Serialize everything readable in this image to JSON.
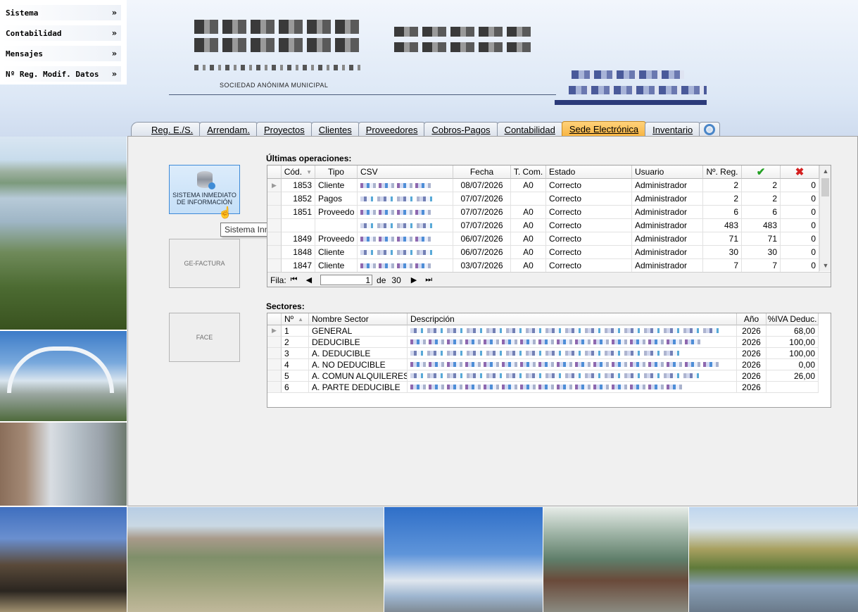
{
  "menu": {
    "items": [
      {
        "label": "Sistema"
      },
      {
        "label": "Contabilidad"
      },
      {
        "label": "Mensajes"
      },
      {
        "label": "Nº Reg. Modif. Datos"
      }
    ],
    "chevron": "»"
  },
  "header": {
    "org_subtitle": "SOCIEDAD ANÓNIMA MUNICIPAL"
  },
  "tabs": [
    {
      "label": "Reg. E./S.",
      "active": false
    },
    {
      "label": "Arrendam.",
      "active": false
    },
    {
      "label": "Proyectos",
      "active": false
    },
    {
      "label": "Clientes",
      "active": false
    },
    {
      "label": "Proveedores",
      "active": false
    },
    {
      "label": "Cobros-Pagos",
      "active": false
    },
    {
      "label": "Contabilidad",
      "active": false
    },
    {
      "label": "Sede Electrónica",
      "active": true
    },
    {
      "label": "Inventario",
      "active": false
    },
    {
      "label": "",
      "icon": "settings-gear-icon"
    }
  ],
  "buttons": {
    "sii": "SISTEMA INMEDIATO DE INFORMACIÓN",
    "gefactura": "GE-FACTURA",
    "face": "FACE"
  },
  "tooltip": "Sistema Inmediato de Información",
  "operations": {
    "title": "Últimas operaciones:",
    "columns": [
      "Cód.",
      "Tipo",
      "CSV",
      "Fecha",
      "T. Com.",
      "Estado",
      "Usuario",
      "Nº. Reg.",
      "✔",
      "✖"
    ],
    "rows": [
      {
        "cod": "1853",
        "tipo": "Cliente",
        "fecha": "08/07/2026",
        "tcom": "A0",
        "estado": "Correcto",
        "usuario": "Administrador",
        "nreg": "2",
        "ok": "2",
        "err": "0"
      },
      {
        "cod": "1852",
        "tipo": "Pagos",
        "fecha": "07/07/2026",
        "tcom": "",
        "estado": "Correcto",
        "usuario": "Administrador",
        "nreg": "2",
        "ok": "2",
        "err": "0"
      },
      {
        "cod": "1851",
        "tipo": "Proveedo",
        "fecha": "07/07/2026",
        "tcom": "A0",
        "estado": "Correcto",
        "usuario": "Administrador",
        "nreg": "6",
        "ok": "6",
        "err": "0"
      },
      {
        "cod": "",
        "tipo": "",
        "fecha": "07/07/2026",
        "tcom": "A0",
        "estado": "Correcto",
        "usuario": "Administrador",
        "nreg": "483",
        "ok": "483",
        "err": "0"
      },
      {
        "cod": "1849",
        "tipo": "Proveedo",
        "fecha": "06/07/2026",
        "tcom": "A0",
        "estado": "Correcto",
        "usuario": "Administrador",
        "nreg": "71",
        "ok": "71",
        "err": "0"
      },
      {
        "cod": "1848",
        "tipo": "Cliente",
        "fecha": "06/07/2026",
        "tcom": "A0",
        "estado": "Correcto",
        "usuario": "Administrador",
        "nreg": "30",
        "ok": "30",
        "err": "0"
      },
      {
        "cod": "1847",
        "tipo": "Cliente",
        "fecha": "03/07/2026",
        "tcom": "A0",
        "estado": "Correcto",
        "usuario": "Administrador",
        "nreg": "7",
        "ok": "7",
        "err": "0"
      }
    ],
    "nav": {
      "label": "Fila:",
      "current": "1",
      "of_label": "de",
      "total": "30"
    }
  },
  "sectors": {
    "title": "Sectores:",
    "columns": [
      "Nº",
      "Nombre Sector",
      "Descripción",
      "Año",
      "%IVA Deduc."
    ],
    "rows": [
      {
        "n": "1",
        "nombre": "GENERAL",
        "anio": "2026",
        "iva": "68,00"
      },
      {
        "n": "2",
        "nombre": "DEDUCIBLE",
        "anio": "2026",
        "iva": "100,00"
      },
      {
        "n": "3",
        "nombre": "A. DEDUCIBLE",
        "anio": "2026",
        "iva": "100,00"
      },
      {
        "n": "4",
        "nombre": "A. NO DEDUCIBLE",
        "anio": "2026",
        "iva": "0,00"
      },
      {
        "n": "5",
        "nombre": "A. COMUN ALQUILERES",
        "anio": "2026",
        "iva": "26,00"
      },
      {
        "n": "6",
        "nombre": "A. PARTE DEDUCIBLE",
        "anio": "2026",
        "iva": ""
      }
    ]
  }
}
